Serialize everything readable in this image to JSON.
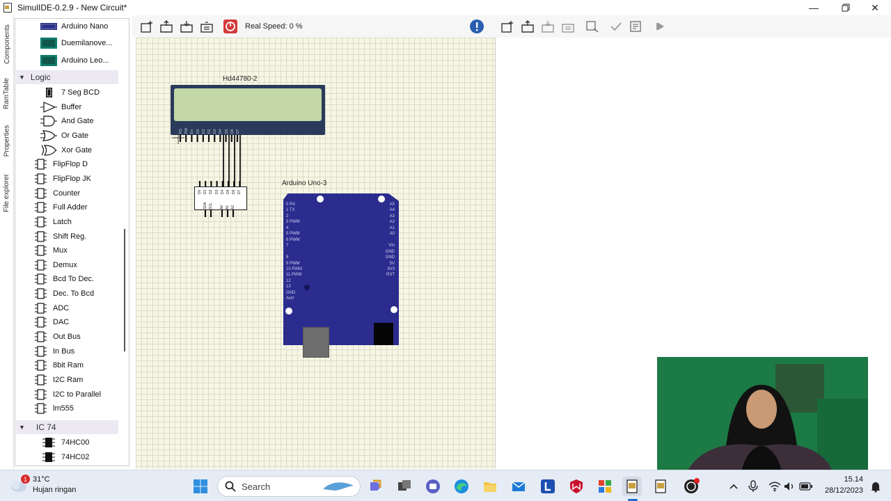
{
  "window": {
    "title": "SimulIDE-0.2.9  -  New Circuit*"
  },
  "side_tabs": [
    "Components",
    "RamTable",
    "Properties",
    "File explorer"
  ],
  "components": {
    "top_items": [
      "Arduino Nano",
      "Duemilanove...",
      "Arduino Leo..."
    ],
    "logic_category": "Logic",
    "logic_items": [
      "7 Seg BCD",
      "Buffer",
      "And Gate",
      "Or Gate",
      "Xor Gate",
      "FlipFlop D",
      "FlipFlop JK",
      "Counter",
      "Full Adder",
      "Latch",
      "Shift Reg.",
      "Mux",
      "Demux",
      "Bcd To Dec.",
      "Dec. To Bcd",
      "ADC",
      "DAC",
      "Out Bus",
      "In Bus",
      "8bit Ram",
      "I2C Ram",
      "I2C to Parallel",
      "lm555"
    ],
    "ic74_category": "IC 74",
    "ic74_items": [
      "74HC00",
      "74HC02"
    ]
  },
  "toolbar": {
    "real_speed": "Real Speed: 0 %"
  },
  "circuit": {
    "lcd_label": "Hd44780-2",
    "lcd_pins": [
      "RS",
      "RW",
      "En",
      "D0",
      "D1",
      "D2",
      "D3",
      "D4",
      "D5",
      "D6",
      "D7"
    ],
    "ic_pins_top": [
      "D0",
      "D1",
      "D2",
      "D3",
      "D4",
      "D5",
      "D6",
      "D7"
    ],
    "ic_pins_bottom": [
      "SDA",
      "SCL",
      "A0",
      "A1",
      "A2"
    ],
    "arduino_label": "Arduino Uno-3",
    "arduino_left_pins": [
      "0 RX",
      "1 TX",
      "2",
      "3 PWM",
      "4",
      "5 PWM",
      "6 PWM",
      "7",
      "",
      "8",
      "9 PWM",
      "10 PWM",
      "11 PWM",
      "12",
      "13",
      "GND",
      "Aref"
    ],
    "arduino_right_pins": [
      "A5",
      "A4",
      "A3",
      "A2",
      "A1",
      "A0",
      "",
      "Vin",
      "GND",
      "GND",
      "5V",
      "3V3",
      "RST"
    ]
  },
  "taskbar": {
    "weather_temp": "31°C",
    "weather_desc": "Hujan ringan",
    "weather_badge": "1",
    "search_label": "Search",
    "time": "15.14",
    "date": "28/12/2023"
  },
  "colors": {
    "canvas_bg": "#f7f6e4",
    "lcd_body": "#2a3a5a",
    "lcd_screen": "#c3d8a6",
    "arduino_board": "#2b2c8e",
    "stop_button": "#d43a3a"
  }
}
